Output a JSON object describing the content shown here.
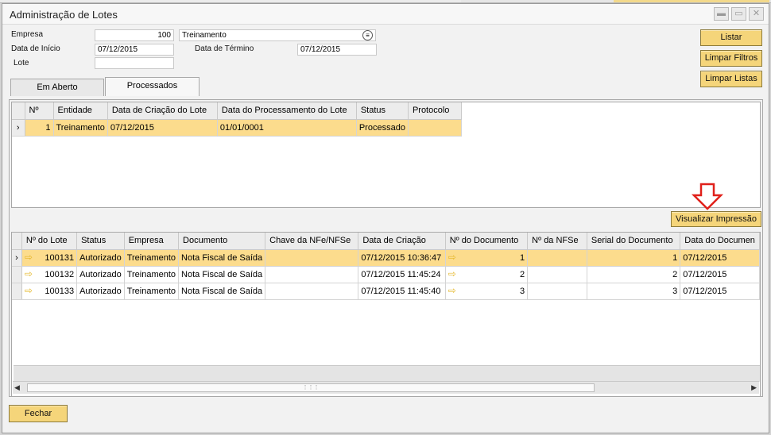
{
  "window": {
    "title": "Administração de Lotes",
    "controls": [
      "minimize-icon",
      "maximize-icon",
      "close-icon"
    ]
  },
  "form": {
    "empresa_label": "Empresa",
    "empresa_value": "100",
    "empresa_name": "Treinamento",
    "data_inicio_label": "Data de Início",
    "data_inicio_value": "07/12/2015",
    "data_termino_label": "Data de Término",
    "data_termino_value": "07/12/2015",
    "lote_label": "Lote",
    "lote_value": ""
  },
  "buttons": {
    "listar": "Listar",
    "limpar_filtros": "Limpar Filtros",
    "limpar_listas": "Limpar Listas",
    "visualizar_impressao": "Visualizar Impressão",
    "fechar": "Fechar"
  },
  "tabs": [
    {
      "label": "Em Aberto",
      "active": false
    },
    {
      "label": "Processados",
      "active": true
    }
  ],
  "lotes_table": {
    "headers": [
      "Nº",
      "Entidade",
      "Data de Criação do Lote",
      "Data do Processamento do Lote",
      "Status",
      "Protocolo"
    ],
    "rows": [
      {
        "n": "1",
        "entidade": "Treinamento",
        "criacao": "07/12/2015",
        "processamento": "01/01/0001",
        "status": "Processado",
        "protocolo": "",
        "selected": true
      }
    ]
  },
  "docs_table": {
    "headers": [
      "Nº do Lote",
      "Status",
      "Empresa",
      "Documento",
      "Chave da NFe/NFSe",
      "Data de Criação",
      "Nº do Documento",
      "Nº da NFSe",
      "Serial do Documento",
      "Data do Documen"
    ],
    "rows": [
      {
        "lote": "100131",
        "status": "Autorizado",
        "empresa": "Treinamento",
        "documento": "Nota Fiscal de Saída",
        "chave": "",
        "criacao": "07/12/2015 10:36:47",
        "ndoc": "1",
        "nfse": "",
        "serial": "1",
        "data": "07/12/2015",
        "selected": true
      },
      {
        "lote": "100132",
        "status": "Autorizado",
        "empresa": "Treinamento",
        "documento": "Nota Fiscal de Saída",
        "chave": "",
        "criacao": "07/12/2015 11:45:24",
        "ndoc": "2",
        "nfse": "",
        "serial": "2",
        "data": "07/12/2015",
        "selected": false
      },
      {
        "lote": "100133",
        "status": "Autorizado",
        "empresa": "Treinamento",
        "documento": "Nota Fiscal de Saída",
        "chave": "",
        "criacao": "07/12/2015 11:45:40",
        "ndoc": "3",
        "nfse": "",
        "serial": "3",
        "data": "07/12/2015",
        "selected": false
      }
    ]
  },
  "colors": {
    "accent_button": "#f5d57a",
    "selected_row": "#fcdc8d",
    "annotation_arrow": "#e0201a"
  }
}
